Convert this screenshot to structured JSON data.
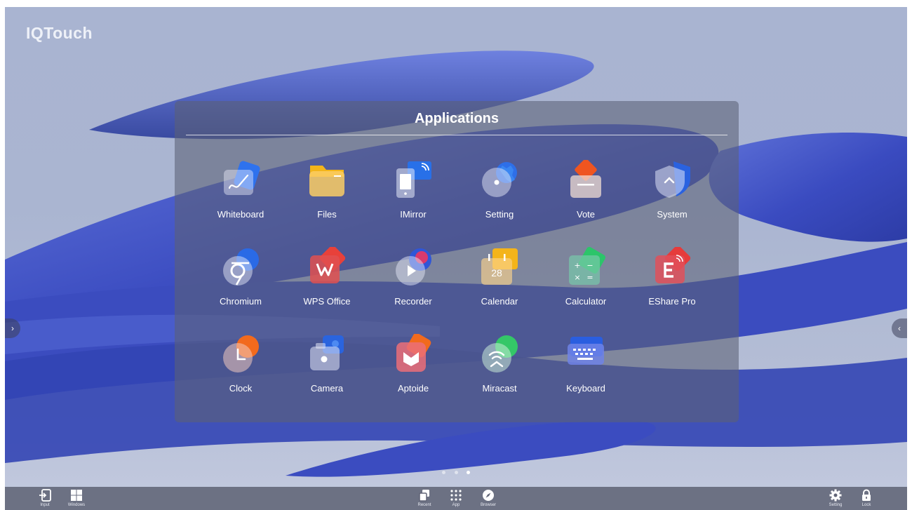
{
  "brand": {
    "logo_text": "IQTouch"
  },
  "panel": {
    "title": "Applications",
    "apps": [
      {
        "label": "Whiteboard",
        "icon": "whiteboard-icon"
      },
      {
        "label": "Files",
        "icon": "folder-icon"
      },
      {
        "label": "IMirror",
        "icon": "screen-mirror-icon"
      },
      {
        "label": "Setting",
        "icon": "gear-icon"
      },
      {
        "label": "Vote",
        "icon": "ballot-box-icon"
      },
      {
        "label": "System",
        "icon": "shield-icon"
      },
      {
        "label": "Chromium",
        "icon": "chromium-icon"
      },
      {
        "label": "WPS Office",
        "icon": "wps-office-icon"
      },
      {
        "label": "Recorder",
        "icon": "record-play-icon"
      },
      {
        "label": "Calendar",
        "icon": "calendar-icon",
        "badge": "28"
      },
      {
        "label": "Calculator",
        "icon": "calculator-icon"
      },
      {
        "label": "EShare Pro",
        "icon": "eshare-icon"
      },
      {
        "label": "Clock",
        "icon": "clock-icon"
      },
      {
        "label": "Camera",
        "icon": "camera-icon"
      },
      {
        "label": "Aptoide",
        "icon": "aptoide-icon"
      },
      {
        "label": "Miracast",
        "icon": "miracast-icon"
      },
      {
        "label": "Keyboard",
        "icon": "keyboard-icon"
      }
    ]
  },
  "pagination": {
    "pages": 3,
    "current": 3
  },
  "taskbar": {
    "left": [
      {
        "label": "Input",
        "icon": "input-source-icon"
      },
      {
        "label": "Windows",
        "icon": "windows-icon"
      }
    ],
    "center": [
      {
        "label": "Recent",
        "icon": "recent-apps-icon"
      },
      {
        "label": "App",
        "icon": "app-grid-icon"
      },
      {
        "label": "Browser",
        "icon": "compass-icon"
      }
    ],
    "right": [
      {
        "label": "Setting",
        "icon": "gear-icon"
      },
      {
        "label": "Lock",
        "icon": "lock-icon"
      }
    ]
  },
  "side_handles": {
    "left_glyph": "›",
    "right_glyph": "‹"
  },
  "colors": {
    "accent_blue": "#3d4fc4",
    "panel_overlay": "#5c6076",
    "taskbar": "#606476"
  }
}
